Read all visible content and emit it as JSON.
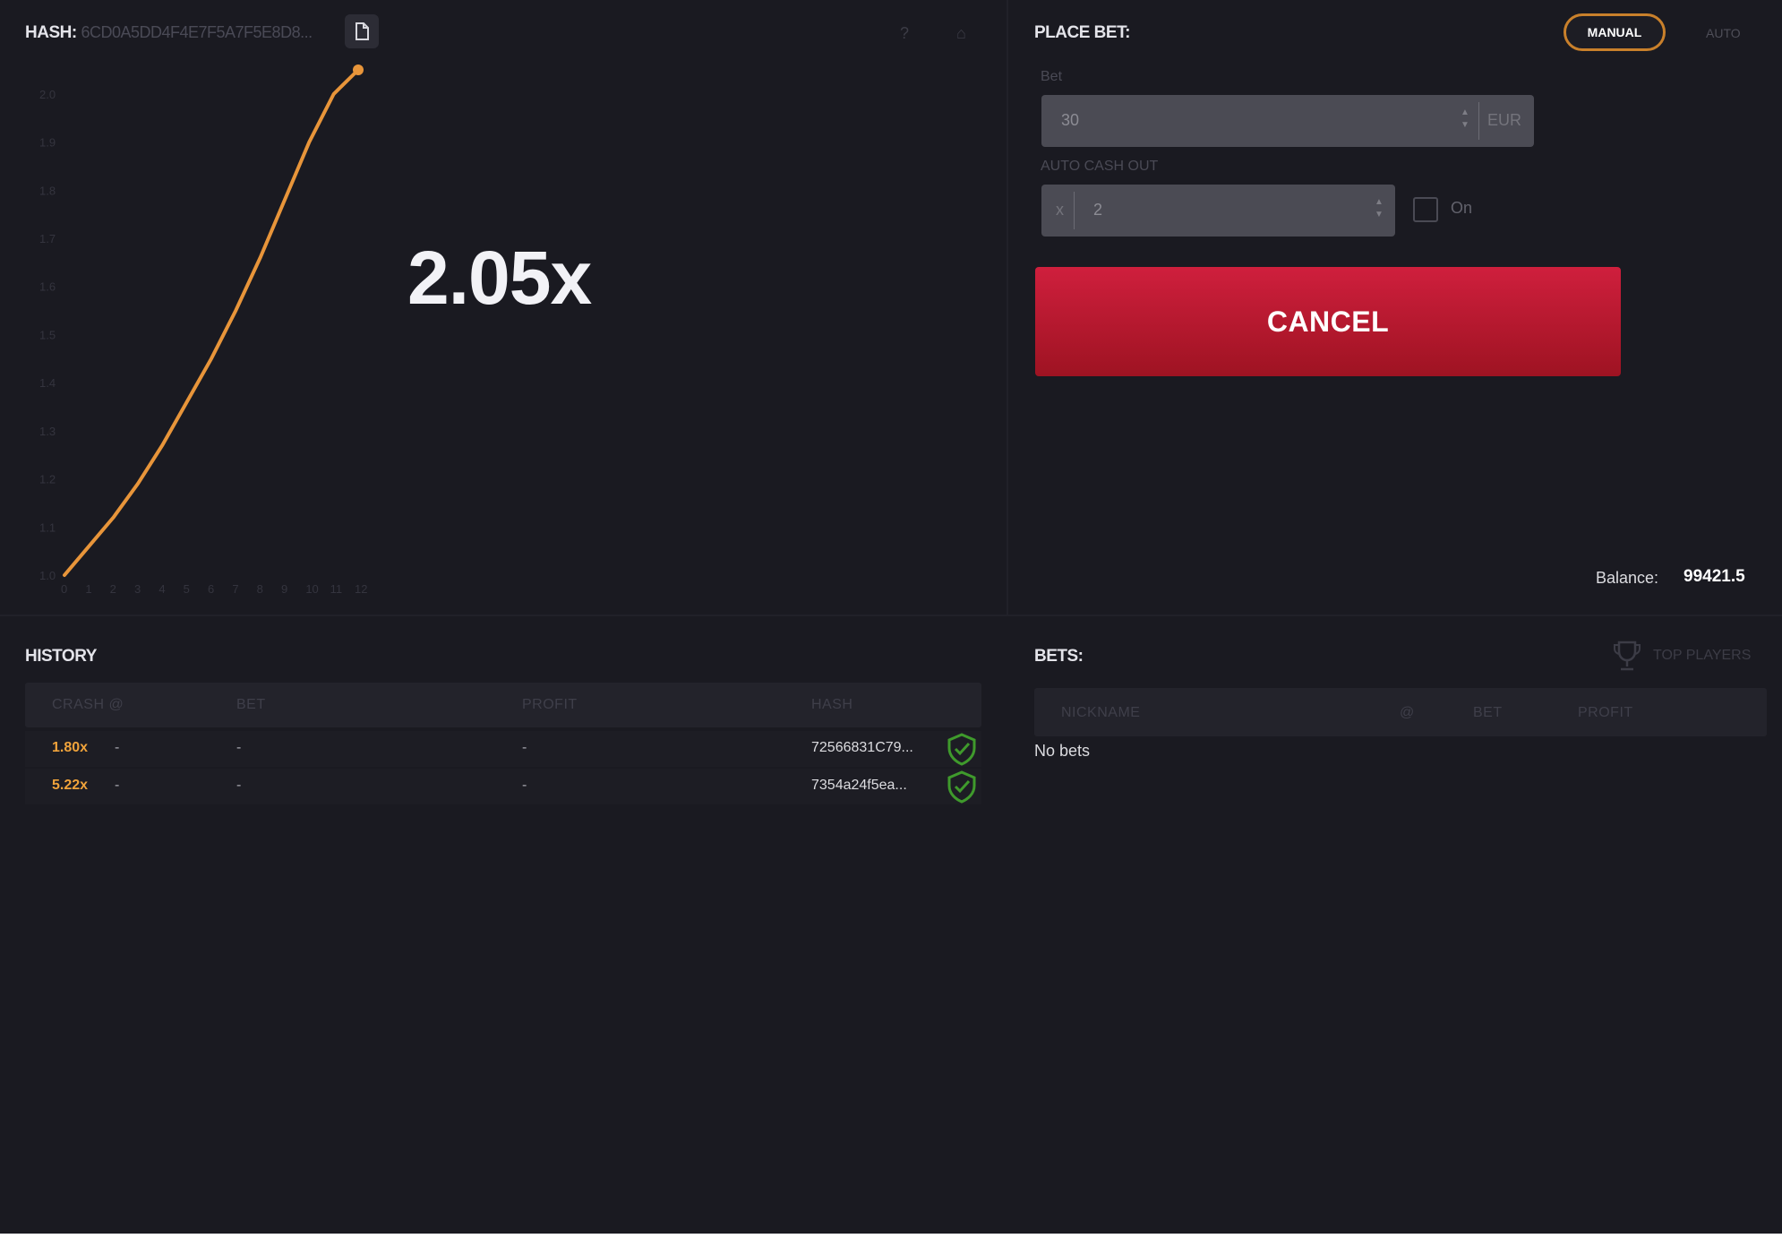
{
  "hash": {
    "label": "HASH:",
    "value": "6CD0A5DD4F4E7F5A7F5E8D8..."
  },
  "multiplier": "2.05x",
  "chart_data": {
    "type": "line",
    "x_ticks": [
      "0",
      "1",
      "2",
      "3",
      "4",
      "5",
      "6",
      "7",
      "8",
      "9",
      "10",
      "11",
      "12"
    ],
    "y_ticks": [
      "1.0",
      "1.1",
      "1.2",
      "1.3",
      "1.4",
      "1.5",
      "1.6",
      "1.7",
      "1.8",
      "1.9",
      "2.0"
    ],
    "xlim": [
      0,
      12
    ],
    "ylim": [
      1.0,
      2.05
    ],
    "series": [
      {
        "color": "#e8953a",
        "points": [
          [
            0,
            1.0
          ],
          [
            1,
            1.06
          ],
          [
            2,
            1.12
          ],
          [
            3,
            1.19
          ],
          [
            4,
            1.27
          ],
          [
            5,
            1.36
          ],
          [
            6,
            1.45
          ],
          [
            7,
            1.55
          ],
          [
            8,
            1.66
          ],
          [
            9,
            1.78
          ],
          [
            10,
            1.9
          ],
          [
            11,
            2.0
          ],
          [
            12,
            2.05
          ]
        ]
      }
    ]
  },
  "bet_panel": {
    "title": "PLACE BET:",
    "tab_manual": "MANUAL",
    "tab_auto": "AUTO",
    "bet_label": "Bet",
    "bet_value": "30",
    "bet_currency": "EUR",
    "auto_cashout_label": "AUTO CASH OUT",
    "auto_cashout_prefix": "x",
    "auto_cashout_value": "2",
    "on_label": "On",
    "cancel_label": "CANCEL",
    "balance_label": "Balance:",
    "balance_value": "99421.5"
  },
  "history": {
    "title": "HISTORY",
    "columns": [
      "CRASH @",
      "BET",
      "PROFIT",
      "HASH"
    ],
    "rows": [
      {
        "crash": "1.80x",
        "dash": "-",
        "bet": "-",
        "profit": "-",
        "hash": "72566831C79..."
      },
      {
        "crash": "5.22x",
        "dash": "-",
        "bet": "-",
        "profit": "-",
        "hash": "7354a24f5ea..."
      }
    ]
  },
  "bets": {
    "title": "BETS:",
    "top_players": "TOP PLAYERS",
    "columns": [
      "NICKNAME",
      "@",
      "BET",
      "PROFIT"
    ],
    "empty_text": "No bets"
  },
  "colors": {
    "background": "#1a1a21",
    "accent": "#e8953a",
    "cancel": "#c41a34",
    "verified": "#3f9a2c"
  }
}
